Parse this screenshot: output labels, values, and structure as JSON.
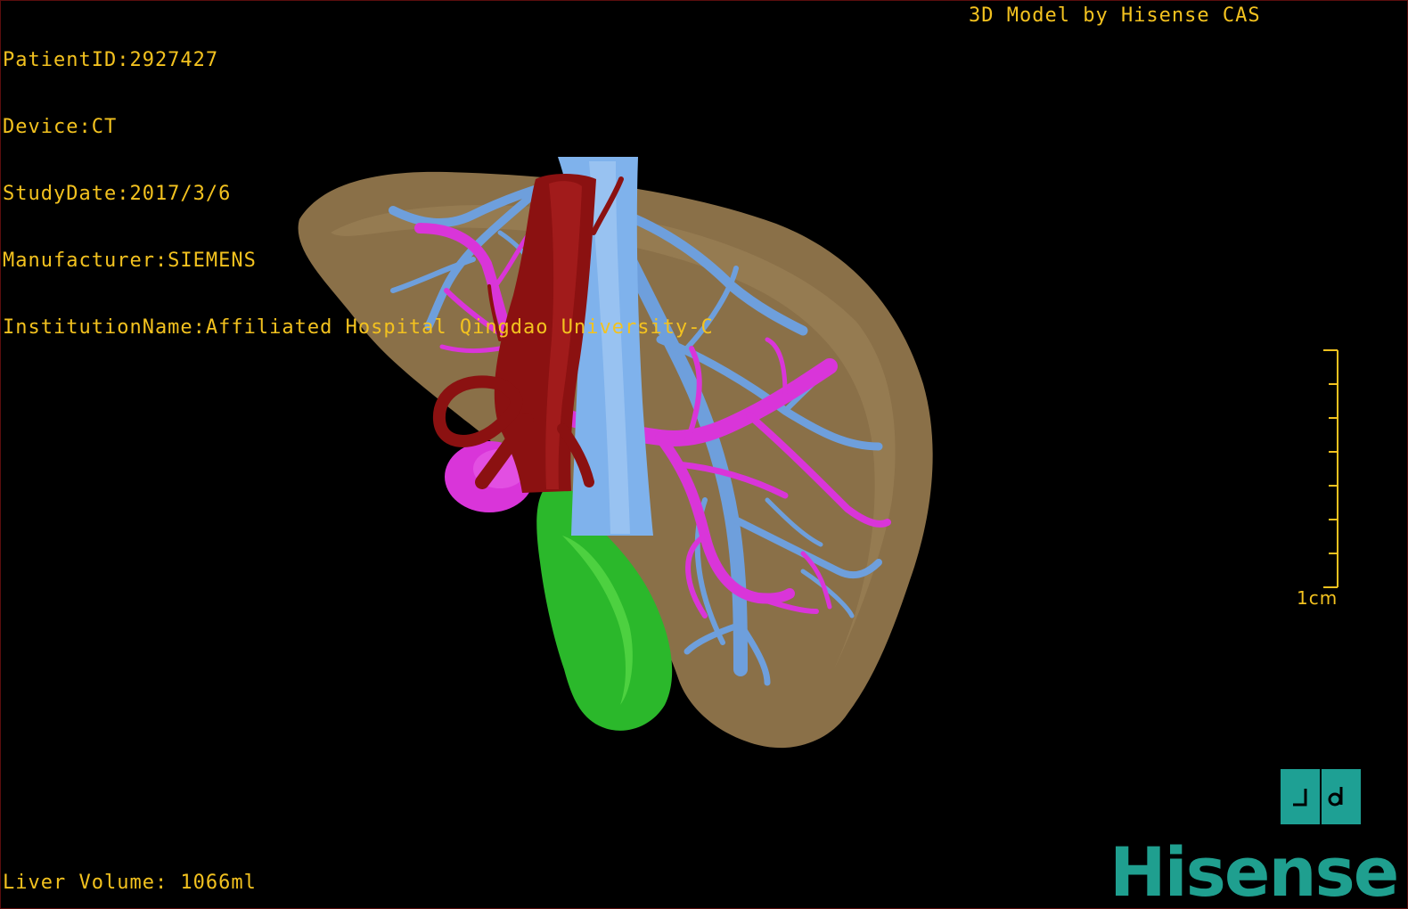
{
  "patient_info": {
    "patient_id": "PatientID:2927427",
    "device": "Device:CT",
    "study_date": "StudyDate:2017/3/6",
    "manufacturer": "Manufacturer:SIEMENS",
    "institution": "InstitutionName:Affiliated Hospital Qingdao University-C"
  },
  "model_credit": "3D Model by Hisense CAS",
  "liver_volume": "Liver Volume: 1066ml",
  "scale_bar": {
    "label": "1cm"
  },
  "view_toggle": {
    "icon": "view-orientation-icon"
  },
  "brand": {
    "logo_text": "Hisense"
  },
  "colors": {
    "overlay_text": "#f3c21f",
    "liver": "#8a7048",
    "portal_vein": "#d935d9",
    "hepatic_vein": "#6e9fdc",
    "artery": "#8b1111",
    "tumor": "#2bb82b",
    "brand": "#1f9f8f"
  }
}
